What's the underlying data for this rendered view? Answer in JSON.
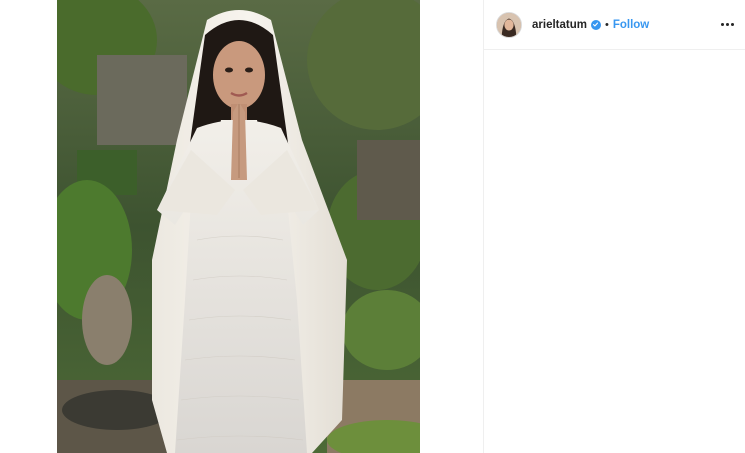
{
  "post": {
    "username": "arieltatum",
    "verified": true,
    "separator": "•",
    "follow_label": "Follow",
    "options_icon": "more-horizontal-icon"
  },
  "colors": {
    "accent": "#3897f0",
    "text": "#262626",
    "divider": "#efefef"
  }
}
